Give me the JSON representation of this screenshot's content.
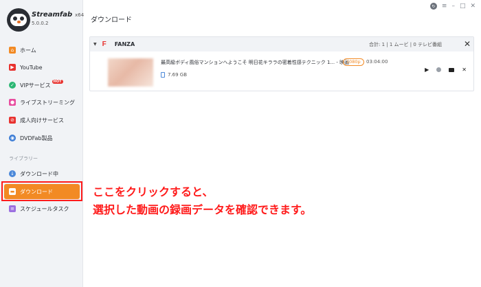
{
  "app": {
    "name": "Streamfab",
    "arch": "x64",
    "version": "5.0.0.2"
  },
  "sidebar": {
    "items": [
      {
        "label": "ホーム",
        "icon": "home-icon",
        "color": "#f28a24"
      },
      {
        "label": "YouTube",
        "icon": "youtube-icon",
        "color": "#e8322f"
      },
      {
        "label": "VIPサービス",
        "icon": "vip-icon",
        "color": "#2bb673",
        "badge": "HOT"
      },
      {
        "label": "ライブストリーミング",
        "icon": "live-icon",
        "color": "#e84ea0"
      },
      {
        "label": "成人向けサービス",
        "icon": "adult-icon",
        "color": "#e8322f"
      },
      {
        "label": "DVDFab製品",
        "icon": "dvdfab-icon",
        "color": "#3a7bd5"
      }
    ],
    "library_label": "ライブラリー",
    "library": [
      {
        "label": "ダウンロード中",
        "icon": "downloading-icon",
        "color": "#4b88d9"
      },
      {
        "label": "ダウンロード",
        "icon": "downloaded-folder-icon",
        "color": "#ffffff",
        "active": true
      },
      {
        "label": "スケジュールタスク",
        "icon": "schedule-icon",
        "color": "#9b6fe0"
      }
    ]
  },
  "main": {
    "title": "ダウンロード",
    "window_controls": [
      "update-icon",
      "menu-icon",
      "minimize-icon",
      "maximize-icon",
      "close-icon"
    ],
    "group": {
      "logo": "F",
      "name": "FANZA",
      "stats": "合計: 1 | 1 ムービ | 0 テレビ番組",
      "items": [
        {
          "title": "最高級ボディ風俗マンションへようこそ 明日花キララの密着性感テクニック 1... - 映画",
          "quality": "1080p",
          "duration": "03:04:00",
          "size": "7.69 GB"
        }
      ]
    }
  },
  "annotation": {
    "line1": "ここをクリックすると、",
    "line2": "選択した動画の録画データを確認できます。",
    "color": "#ff1a1a"
  }
}
